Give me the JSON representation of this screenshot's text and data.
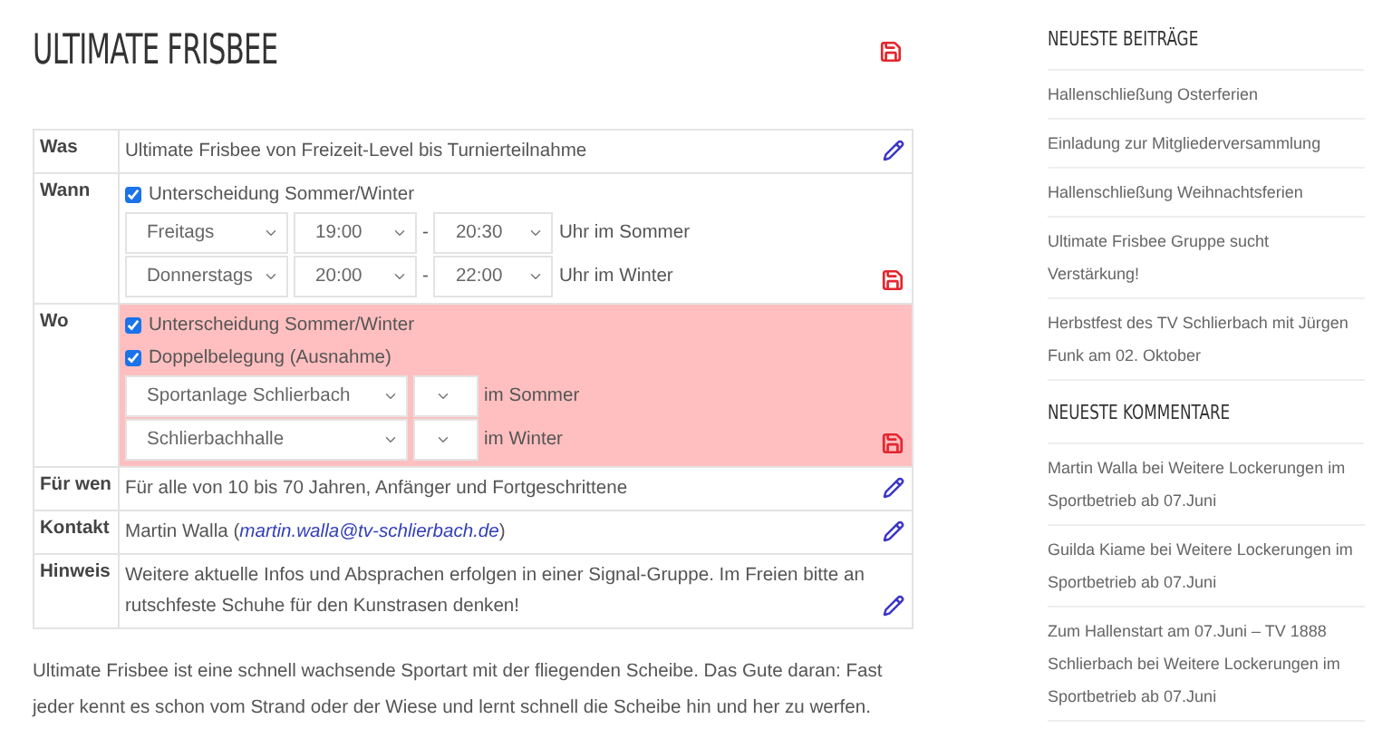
{
  "page": {
    "title": "ULTIMATE FRISBEE"
  },
  "details": [
    {
      "label": "Was",
      "kind": "text",
      "value": "Ultimate Frisbee von Freizeit-Level bis Turnierteilnahme",
      "highlighted": false
    },
    {
      "label": "Wann",
      "kind": "schedule",
      "highlighted": false,
      "checkboxes": [
        {
          "label": "Unterscheidung Sommer/Winter",
          "checked": true
        }
      ],
      "lines": [
        {
          "day": "Freitags",
          "from": "19:00",
          "separator": "-",
          "to": "20:30",
          "suffix": "Uhr im Sommer"
        },
        {
          "day": "Donnerstags",
          "from": "20:00",
          "separator": "-",
          "to": "22:00",
          "suffix": "Uhr im Winter"
        }
      ]
    },
    {
      "label": "Wo",
      "kind": "location",
      "highlighted": true,
      "checkboxes": [
        {
          "label": "Unterscheidung Sommer/Winter",
          "checked": true
        },
        {
          "label": "Doppelbelegung (Ausnahme)",
          "checked": true
        }
      ],
      "lines": [
        {
          "place": "Sportanlage Schlierbach",
          "suffix": "im Sommer"
        },
        {
          "place": "Schlierbachhalle",
          "suffix": "im Winter"
        }
      ]
    },
    {
      "label": "Für wen",
      "kind": "text",
      "value": "Für alle von 10 bis 70 Jahren, Anfänger und Fortgeschrittene",
      "highlighted": false
    },
    {
      "label": "Kontakt",
      "kind": "contact",
      "name": "Martin Walla",
      "open": "(",
      "email": "martin.walla@tv-schlierbach.de",
      "close": ")",
      "highlighted": false
    },
    {
      "label": "Hinweis",
      "kind": "text",
      "value": "Weitere aktuelle Infos und Absprachen erfolgen in einer Signal-Gruppe. Im Freien bitte an rutschfeste Schuhe für den Kunstrasen denken!",
      "highlighted": false
    }
  ],
  "description": "Ultimate Frisbee ist eine schnell wachsende Sportart mit der fliegenden Scheibe. Das Gute daran: Fast jeder kennt es schon vom Strand oder der Wiese und lernt schnell die Scheibe hin und her zu werfen.",
  "sidebar": [
    {
      "heading": "NEUESTE BEITRÄGE",
      "items": [
        "Hallenschließung Osterferien",
        "Einladung zur Mitgliederversammlung",
        "Hallenschließung Weihnachtsferien",
        "Ultimate Frisbee Gruppe sucht Verstärkung!",
        "Herbstfest des TV Schlierbach mit Jürgen Funk am 02. Oktober"
      ]
    },
    {
      "heading": "NEUESTE KOMMENTARE",
      "items": [
        "Martin Walla bei Weitere Lockerungen im Sportbetrieb ab 07.Juni",
        "Guilda Kiame bei Weitere Lockerungen im Sportbetrieb ab 07.Juni",
        "Zum Hallenstart am 07.Juni – TV 1888 Schlierbach bei Weitere Lockerungen im Sportbetrieb ab 07.Juni"
      ]
    }
  ]
}
